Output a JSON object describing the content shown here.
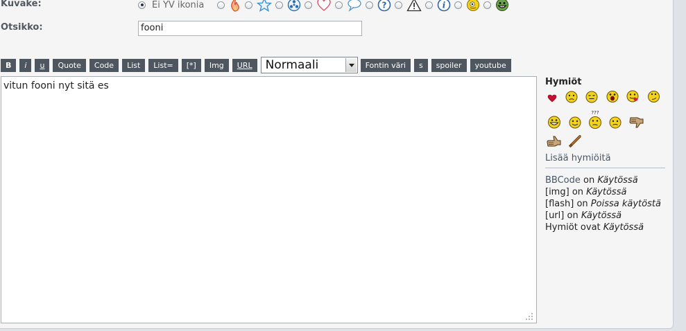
{
  "form": {
    "icon_label": "Kuvake:",
    "title_label": "Otsikko:",
    "title_value": "fooni",
    "icon_options": [
      {
        "name": "no-icon",
        "text": "Ei YV ikonia",
        "selected": true
      },
      {
        "name": "flame-icon",
        "selected": false
      },
      {
        "name": "star-icon",
        "selected": false
      },
      {
        "name": "radiation-icon",
        "selected": false
      },
      {
        "name": "heart-icon",
        "selected": false
      },
      {
        "name": "speech-bubble-icon",
        "selected": false
      },
      {
        "name": "question-icon",
        "selected": false
      },
      {
        "name": "warning-icon",
        "selected": false
      },
      {
        "name": "info-icon",
        "selected": false
      },
      {
        "name": "lemon-face-icon",
        "selected": false
      },
      {
        "name": "grin-face-icon",
        "selected": false
      }
    ]
  },
  "toolbar": {
    "bold": "B",
    "italic": "i",
    "underline": "u",
    "quote": "Quote",
    "code": "Code",
    "list": "List",
    "list_eq": "List=",
    "list_item": "[*]",
    "img": "Img",
    "url": "URL",
    "size_select": "Normaali",
    "font_color": "Fontin väri",
    "strike": "s",
    "spoiler": "spoiler",
    "youtube": "youtube"
  },
  "editor": {
    "text": "vitun fooni nyt sitä es"
  },
  "sidebar": {
    "title": "Hymiöt",
    "smilies": [
      "heart",
      "sad",
      "meh",
      "shocked",
      "tongue",
      "rolleyes",
      "grin",
      "smile",
      "confused",
      "frown",
      "thumbs-down",
      "thumbs-up",
      "baseball-bat"
    ],
    "more_link": "Lisää hymiöitä",
    "status": {
      "bbcode_label": "BBCode",
      "bbcode_on": "on",
      "bbcode_value": "Käytössä",
      "img_label": "[img]",
      "img_on": "on",
      "img_value": "Käytössä",
      "flash_label": "[flash]",
      "flash_on": "on",
      "flash_value": "Poissa käytöstä",
      "url_label": "[url]",
      "url_on": "on",
      "url_value": "Käytössä",
      "smilies_label": "Hymiöt ovat",
      "smilies_value": "Käytössä"
    }
  },
  "colors": {
    "button_bg": "#4e5760",
    "panel_bg": "#f5f5f6",
    "page_bg": "#dfe3e8",
    "smiley_yellow": "#f2d21b"
  }
}
